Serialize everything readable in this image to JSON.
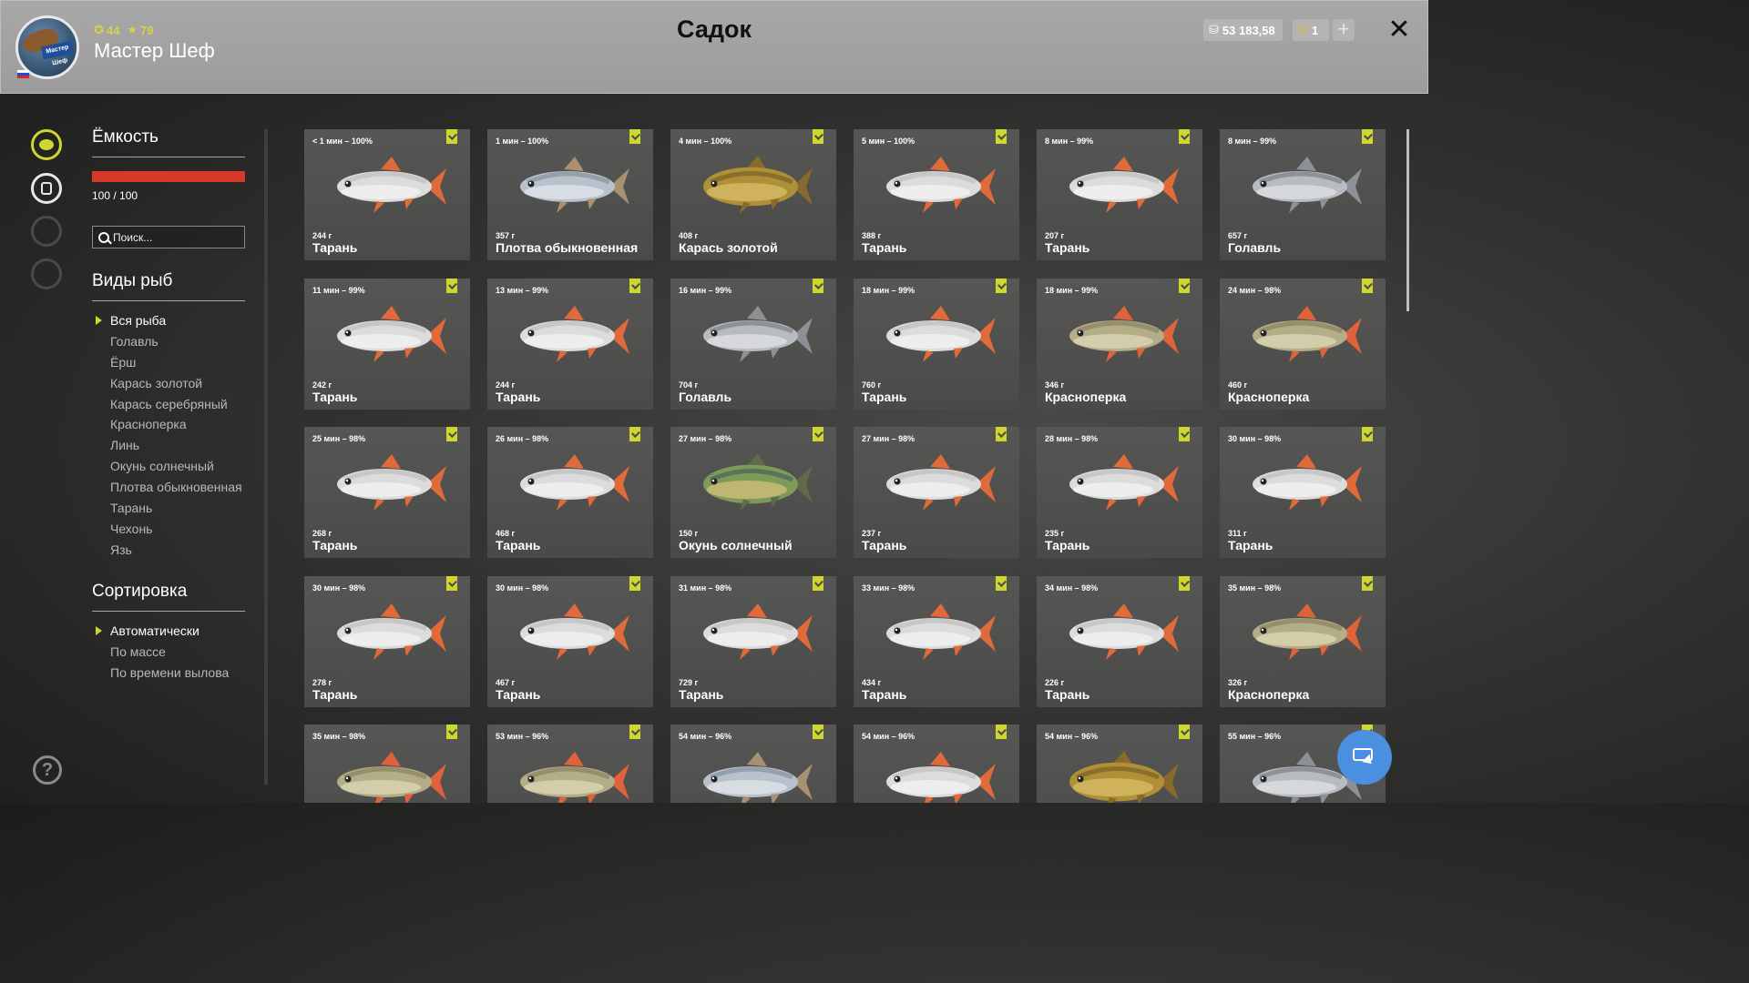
{
  "header": {
    "title": "Садок",
    "player_name": "Мастер Шеф",
    "avatar_banner": "Мастер Шеф",
    "level": "44",
    "rank": "79",
    "money": "53 183,58",
    "gold": "1",
    "plus_label": "+",
    "close_label": "✕"
  },
  "panel": {
    "capacity_heading": "Ёмкость",
    "capacity_text": "100 / 100",
    "capacity_fraction": 1.0,
    "search_placeholder": "Поиск...",
    "species_heading": "Виды рыб",
    "species": [
      "Вся рыба",
      "Голавль",
      "Ёрш",
      "Карась золотой",
      "Карась серебряный",
      "Красноперка",
      "Линь",
      "Окунь солнечный",
      "Плотва обыкновенная",
      "Тарань",
      "Чехонь",
      "Язь"
    ],
    "sort_heading": "Сортировка",
    "sort_options": [
      "Автоматически",
      "По массе",
      "По времени вылова"
    ]
  },
  "help_label": "?",
  "colors": {
    "accent": "#cfd62f",
    "capacity": "#d6382b",
    "header_bg": "#a0a0a0",
    "card_bg": "#505050",
    "action": "#4a8fe0"
  },
  "fish_cards": [
    {
      "time": "< 1 мин – 100%",
      "weight": "244 г",
      "name": "Тарань",
      "kind": "taran"
    },
    {
      "time": "1 мин – 100%",
      "weight": "357 г",
      "name": "Плотва обыкновенная",
      "kind": "plotva"
    },
    {
      "time": "4 мин – 100%",
      "weight": "408 г",
      "name": "Карась золотой",
      "kind": "karas"
    },
    {
      "time": "5 мин – 100%",
      "weight": "388 г",
      "name": "Тарань",
      "kind": "taran"
    },
    {
      "time": "8 мин – 99%",
      "weight": "207 г",
      "name": "Тарань",
      "kind": "taran"
    },
    {
      "time": "8 мин – 99%",
      "weight": "657 г",
      "name": "Голавль",
      "kind": "golavl"
    },
    {
      "time": "11 мин – 99%",
      "weight": "242 г",
      "name": "Тарань",
      "kind": "taran"
    },
    {
      "time": "13 мин – 99%",
      "weight": "244 г",
      "name": "Тарань",
      "kind": "taran"
    },
    {
      "time": "16 мин – 99%",
      "weight": "704 г",
      "name": "Голавль",
      "kind": "golavl"
    },
    {
      "time": "18 мин – 99%",
      "weight": "760 г",
      "name": "Тарань",
      "kind": "taran"
    },
    {
      "time": "18 мин – 99%",
      "weight": "346 г",
      "name": "Красноперка",
      "kind": "krasnoperka"
    },
    {
      "time": "24 мин – 98%",
      "weight": "460 г",
      "name": "Красноперка",
      "kind": "krasnoperka"
    },
    {
      "time": "25 мин – 98%",
      "weight": "268 г",
      "name": "Тарань",
      "kind": "taran"
    },
    {
      "time": "26 мин – 98%",
      "weight": "468 г",
      "name": "Тарань",
      "kind": "taran"
    },
    {
      "time": "27 мин – 98%",
      "weight": "150 г",
      "name": "Окунь солнечный",
      "kind": "okun"
    },
    {
      "time": "27 мин – 98%",
      "weight": "237 г",
      "name": "Тарань",
      "kind": "taran"
    },
    {
      "time": "28 мин – 98%",
      "weight": "235 г",
      "name": "Тарань",
      "kind": "taran"
    },
    {
      "time": "30 мин – 98%",
      "weight": "311 г",
      "name": "Тарань",
      "kind": "taran"
    },
    {
      "time": "30 мин – 98%",
      "weight": "278 г",
      "name": "Тарань",
      "kind": "taran"
    },
    {
      "time": "30 мин – 98%",
      "weight": "467 г",
      "name": "Тарань",
      "kind": "taran"
    },
    {
      "time": "31 мин – 98%",
      "weight": "729 г",
      "name": "Тарань",
      "kind": "taran"
    },
    {
      "time": "33 мин – 98%",
      "weight": "434 г",
      "name": "Тарань",
      "kind": "taran"
    },
    {
      "time": "34 мин – 98%",
      "weight": "226 г",
      "name": "Тарань",
      "kind": "taran"
    },
    {
      "time": "35 мин – 98%",
      "weight": "326 г",
      "name": "Красноперка",
      "kind": "krasnoperka"
    },
    {
      "time": "35 мин – 98%",
      "weight": "",
      "name": "",
      "kind": "krasnoperka"
    },
    {
      "time": "53 мин – 96%",
      "weight": "",
      "name": "",
      "kind": "krasnoperka"
    },
    {
      "time": "54 мин – 96%",
      "weight": "",
      "name": "",
      "kind": "plotva"
    },
    {
      "time": "54 мин – 96%",
      "weight": "",
      "name": "",
      "kind": "taran"
    },
    {
      "time": "54 мин – 96%",
      "weight": "",
      "name": "",
      "kind": "karas"
    },
    {
      "time": "55 мин – 96%",
      "weight": "",
      "name": "",
      "kind": "golavl"
    }
  ]
}
